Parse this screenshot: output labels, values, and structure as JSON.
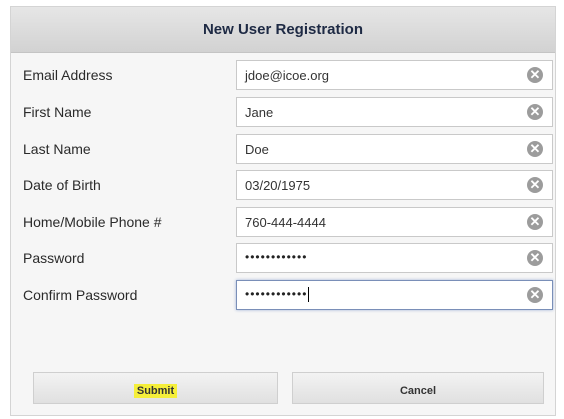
{
  "dialog": {
    "title": "New User Registration",
    "fields": [
      {
        "label": "Email Address",
        "value": "jdoe@icoe.org"
      },
      {
        "label": "First Name",
        "value": "Jane"
      },
      {
        "label": "Last Name",
        "value": "Doe"
      },
      {
        "label": "Date of Birth",
        "value": "03/20/1975"
      },
      {
        "label": "Home/Mobile Phone #",
        "value": "760-444-4444"
      },
      {
        "label": "Password",
        "value": "••••••••••••"
      },
      {
        "label": "Confirm Password",
        "value": "••••••••••••"
      }
    ],
    "clear_glyph": "✕",
    "submit_label": "Submit",
    "cancel_label": "Cancel"
  },
  "colors": {
    "title_text": "#1e2a44",
    "submit_highlight": "#f5ef3a",
    "clear_icon": "#9c9c9c"
  }
}
